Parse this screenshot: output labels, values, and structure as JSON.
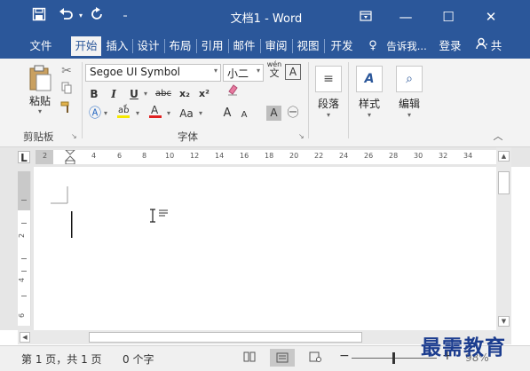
{
  "titlebar": {
    "title": "文档1 - Word",
    "save_icon": "save-icon",
    "undo_icon": "undo-icon",
    "redo_icon": "redo-icon",
    "customize_icon": "customize-qat-icon",
    "ribbon_display_icon": "ribbon-display-icon",
    "minimize_icon": "minimize-icon",
    "maximize_icon": "maximize-icon",
    "close_icon": "close-icon",
    "color": "#2b579a"
  },
  "menu": {
    "tabs": [
      "文件",
      "开始",
      "插入",
      "设计",
      "布局",
      "引用",
      "邮件",
      "审阅",
      "视图",
      "开发"
    ],
    "active_tab": "开始",
    "tell_me": "告诉我...",
    "login": "登录",
    "share": "共"
  },
  "ribbon": {
    "clipboard": {
      "paste": "粘贴",
      "label": "剪贴板"
    },
    "font": {
      "font_name": "Segoe UI Symbol",
      "font_size": "小二",
      "bold": "B",
      "italic": "I",
      "underline": "U",
      "strike": "abc",
      "subscript": "x₂",
      "superscript": "x²",
      "change_case": "Aa",
      "grow": "A",
      "shrink": "A",
      "char_border": "A",
      "enclose": "㊀",
      "phonetic": "wén",
      "label": "字体"
    },
    "paragraph": {
      "label": "段落"
    },
    "styles": {
      "label": "样式"
    },
    "editing": {
      "label": "编辑"
    }
  },
  "ruler": {
    "tab_marker": "L",
    "h_numbers": [
      "2",
      "2",
      "4",
      "6",
      "8",
      "10",
      "12",
      "14",
      "16",
      "18",
      "20",
      "22",
      "24",
      "26",
      "28",
      "30",
      "32",
      "34"
    ],
    "v_numbers": [
      "2",
      "4",
      "6"
    ]
  },
  "statusbar": {
    "page": "第 1 页，共 1 页",
    "words": "0 个字",
    "zoom_out": "−",
    "zoom_in": "+",
    "zoom": "98%"
  },
  "watermark": "最需教育"
}
